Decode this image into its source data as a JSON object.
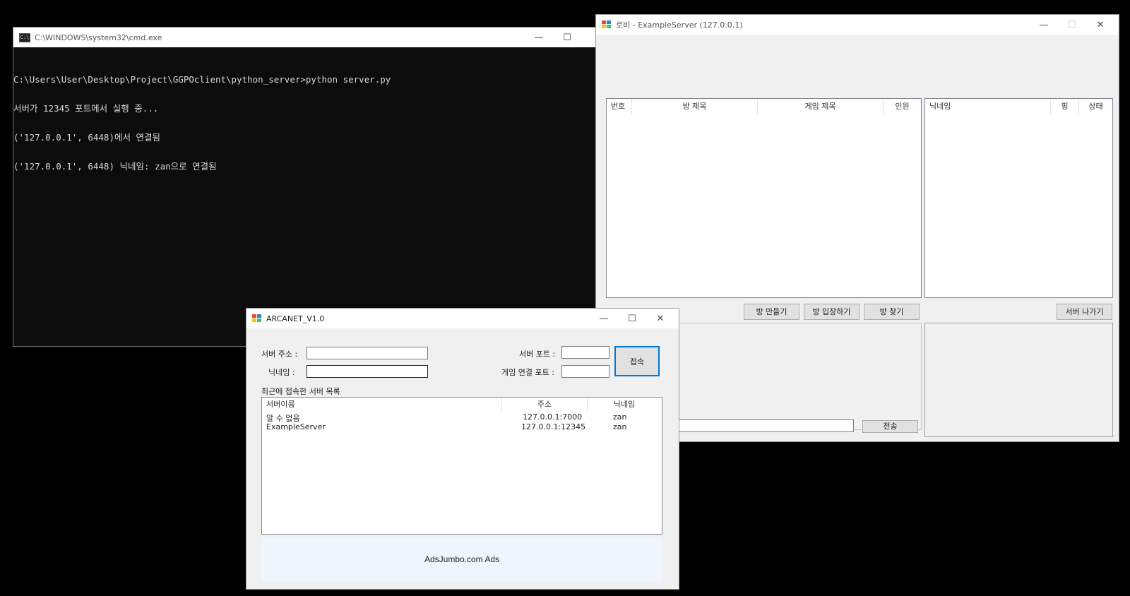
{
  "cmd": {
    "title": "C:\\WINDOWS\\system32\\cmd.exe",
    "lines": [
      "C:\\Users\\User\\Desktop\\Project\\GGPOclient\\python_server>python server.py",
      "서버가 12345 포트에서 실행 중...",
      "('127.0.0.1', 6448)에서 연결됨",
      "('127.0.0.1', 6448) 닉네임: zan으로 연결됨"
    ]
  },
  "lobby": {
    "title": "로비 - ExampleServer (127.0.0.1)",
    "room_columns": [
      "번호",
      "방 제목",
      "게임 제목",
      "인원"
    ],
    "user_columns": [
      "닉네임",
      "핑",
      "상태"
    ],
    "buttons": {
      "create_room": "방 만들기",
      "join_room": "방 입장하기",
      "find_room": "방 찾기",
      "leave_server": "서버 나가기",
      "send": "전송"
    }
  },
  "arcanet": {
    "title": "ARCANET_V1.0",
    "labels": {
      "server_address": "서버 주소 :",
      "nickname": "닉네임 :",
      "server_port": "서버 포트 :",
      "game_port": "게임 연결 포트 :",
      "recent_servers": "최근에 접속한 서버 목록"
    },
    "connect_button": "접속",
    "list_columns": [
      "서버이름",
      "주소",
      "닉네임"
    ],
    "servers": [
      {
        "name": "알 수 없음",
        "address": "127.0.0.1:7000",
        "nickname": "zan"
      },
      {
        "name": "ExampleServer",
        "address": "127.0.0.1:12345",
        "nickname": "zan"
      }
    ],
    "ad_text": "AdsJumbo.com Ads"
  },
  "window_controls": {
    "minimize": "—",
    "maximize": "☐",
    "close": "✕"
  },
  "colors": {
    "console_bg": "#0c0c0c",
    "console_text": "#d8d8d8",
    "accent_border": "#0078d7",
    "ad_bg": "#eef5fc"
  }
}
